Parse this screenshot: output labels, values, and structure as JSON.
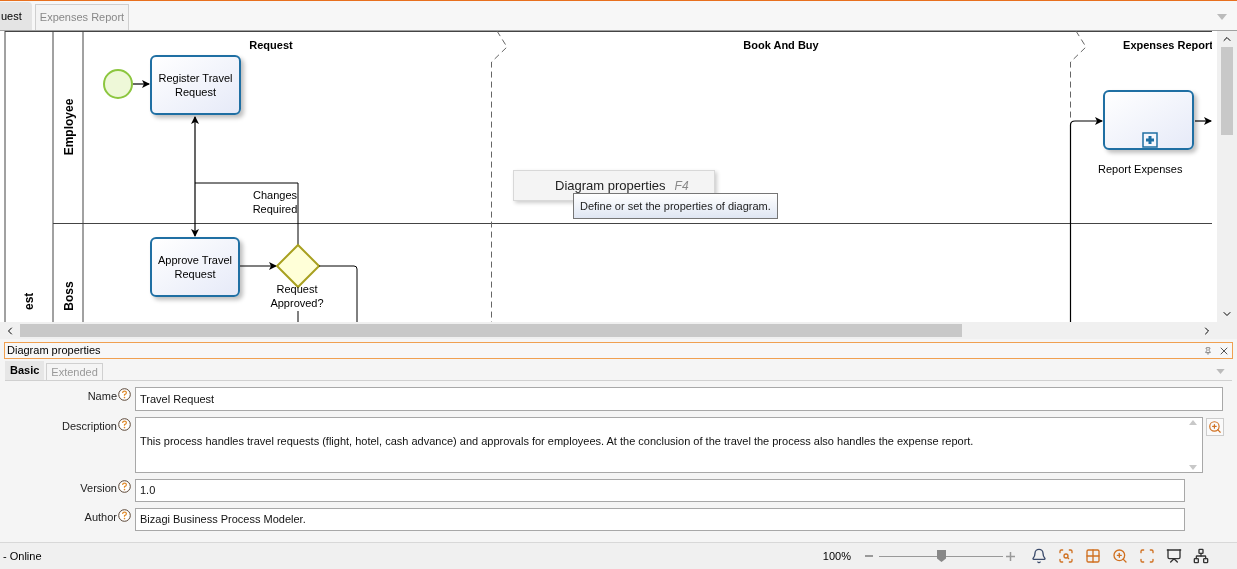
{
  "document_tabs": [
    {
      "label": "uest",
      "selected": true
    },
    {
      "label": "Expenses Report",
      "selected": false
    }
  ],
  "diagram": {
    "pool_label": "est",
    "lanes": [
      {
        "label": "Employee"
      },
      {
        "label": "Boss"
      }
    ],
    "phases": [
      {
        "label": "Request"
      },
      {
        "label": "Book And Buy"
      },
      {
        "label": "Expenses Report"
      }
    ],
    "tasks": [
      {
        "label": "Register Travel Request",
        "kind": "task"
      },
      {
        "label": "Approve Travel Request",
        "kind": "task"
      },
      {
        "label": "Report Expenses",
        "kind": "subprocess"
      }
    ],
    "gateway": {
      "label": "Request Approved?"
    },
    "flow_label": "Changes Required"
  },
  "context_menu": {
    "item": "Diagram properties",
    "shortcut": "F4",
    "tooltip": "Define or set the properties of diagram."
  },
  "properties_panel": {
    "title": "Diagram properties",
    "tabs": [
      {
        "label": "Basic",
        "selected": true
      },
      {
        "label": "Extended",
        "selected": false
      }
    ],
    "fields": [
      {
        "label": "Name",
        "value": "Travel Request",
        "kind": "text"
      },
      {
        "label": "Description",
        "value": "This process handles travel requests (flight, hotel, cash advance) and approvals for employees. At the conclusion of the travel the process also handles the expense report.",
        "kind": "multiline"
      },
      {
        "label": "Version",
        "value": "1.0",
        "kind": "short"
      },
      {
        "label": "Author",
        "value": "Bizagi Business Process Modeler.",
        "kind": "short"
      }
    ]
  },
  "status_bar": {
    "status": "- Online",
    "zoom": "100%",
    "zoom_slider": {
      "level": 0.5
    }
  }
}
